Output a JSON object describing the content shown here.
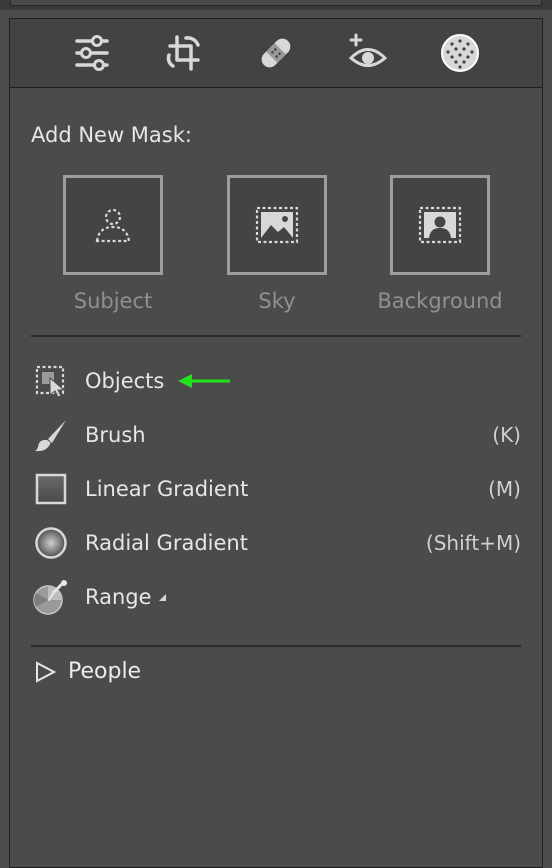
{
  "toolbar": {
    "tools": [
      {
        "name": "edit",
        "icon": "sliders-icon"
      },
      {
        "name": "crop",
        "icon": "crop-icon"
      },
      {
        "name": "heal",
        "icon": "bandage-icon"
      },
      {
        "name": "red-eye",
        "icon": "eye-plus-icon"
      },
      {
        "name": "masking",
        "icon": "masking-circle-icon"
      }
    ]
  },
  "add_mask": {
    "label": "Add New Mask:",
    "presets": [
      {
        "label": "Subject",
        "icon": "subject-icon"
      },
      {
        "label": "Sky",
        "icon": "sky-icon"
      },
      {
        "label": "Background",
        "icon": "background-icon"
      }
    ]
  },
  "mask_tools": [
    {
      "label": "Objects",
      "shortcut": "",
      "icon": "objects-icon"
    },
    {
      "label": "Brush",
      "shortcut": "(K)",
      "icon": "brush-icon"
    },
    {
      "label": "Linear Gradient",
      "shortcut": "(M)",
      "icon": "linear-gradient-icon"
    },
    {
      "label": "Radial Gradient",
      "shortcut": "(Shift+M)",
      "icon": "radial-gradient-icon"
    },
    {
      "label": "Range",
      "shortcut": "",
      "icon": "range-icon"
    }
  ],
  "people": {
    "label": "People"
  },
  "colors": {
    "annotation_arrow": "#22e21a",
    "panel_bg": "#4b4b4b",
    "toolbar_bg": "#434343"
  }
}
